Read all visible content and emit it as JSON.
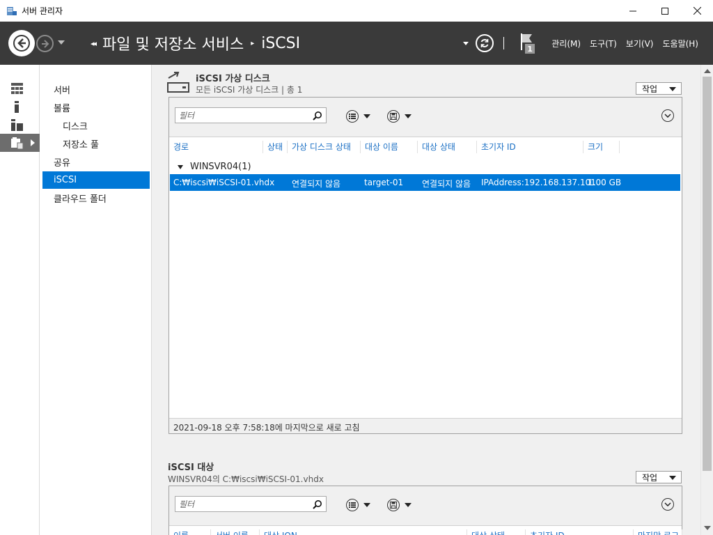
{
  "window": {
    "title": "서버 관리자",
    "minimize": "—",
    "maximize": "☐",
    "close": "✕"
  },
  "header": {
    "breadcrumb_root": "파일 및 저장소 서비스",
    "breadcrumb_current": "iSCSI",
    "notification_count": "1",
    "menu": [
      "관리(M)",
      "도구(T)",
      "보기(V)",
      "도움말(H)"
    ]
  },
  "nav": {
    "items": [
      {
        "label": "서버",
        "sub": false
      },
      {
        "label": "볼륨",
        "sub": false
      },
      {
        "label": "디스크",
        "sub": true
      },
      {
        "label": "저장소 풀",
        "sub": true
      },
      {
        "label": "공유",
        "sub": false
      },
      {
        "label": "iSCSI",
        "sub": false,
        "selected": true
      },
      {
        "label": "클라우드 폴더",
        "sub": false
      }
    ]
  },
  "disks": {
    "title": "iSCSI 가상 디스크",
    "subtitle": "모든 iSCSI 가상 디스크 | 총 1",
    "tasks_label": "작업",
    "filter_placeholder": "필터",
    "columns": [
      "경로",
      "상태",
      "가상 디스크 상태",
      "대상 이름",
      "대상 상태",
      "초기자 ID",
      "크기"
    ],
    "group": "WINSVR04(1)",
    "row": {
      "path": "C:₩iscsi₩iSCSI-01.vhdx",
      "status": "",
      "disk_status": "연결되지 않음",
      "target_name": "target-01",
      "target_status": "연결되지 않음",
      "initiator_id": "IPAddress:192.168.137.101",
      "size": "1.00 GB"
    },
    "footer": "2021-09-18 오후 7:58:18에 마지막으로 새로 고침"
  },
  "targets": {
    "title": "iSCSI 대상",
    "subtitle": "WINSVR04의 C:₩iscsi₩iSCSI-01.vhdx",
    "tasks_label": "작업",
    "filter_placeholder": "필터",
    "columns": [
      "이름",
      "서버 이름",
      "대상 IQN",
      "대상 상태",
      "초기자 ID",
      "마지막 로그"
    ]
  },
  "colors": {
    "header_bg": "#3a3a3a",
    "selection": "#0078d7",
    "column_header": "#1a6fc4"
  }
}
